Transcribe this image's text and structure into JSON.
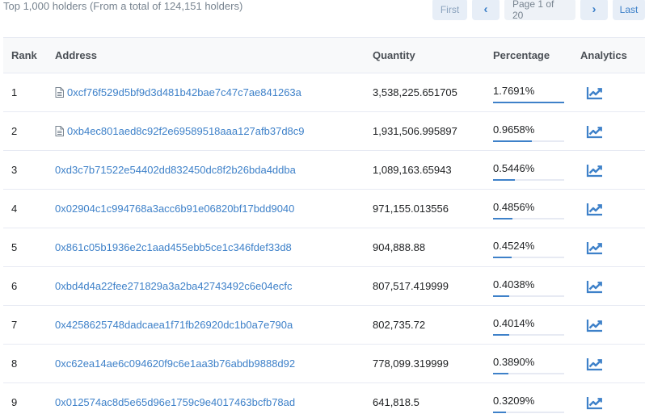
{
  "summary": "Top 1,000 holders (From a total of 124,151 holders)",
  "pager": {
    "first": "First",
    "prev": "‹",
    "info": "Page 1 of 20",
    "next": "›",
    "last": "Last"
  },
  "columns": {
    "rank": "Rank",
    "address": "Address",
    "quantity": "Quantity",
    "percentage": "Percentage",
    "analytics": "Analytics"
  },
  "accent": "#3e81c9",
  "icons": {
    "contract": "contract-doc-icon",
    "analytics": "chart-trend-icon"
  },
  "rows": [
    {
      "rank": "1",
      "address": "0xcf76f529d5bf9d3d481b42bae7c47c7ae841263a",
      "contract": true,
      "quantity": "3,538,225.651705",
      "percentage": "1.7691%",
      "pct_fill": 1.0
    },
    {
      "rank": "2",
      "address": "0xb4ec801aed8c92f2e69589518aaa127afb37d8c9",
      "contract": true,
      "quantity": "1,931,506.995897",
      "percentage": "0.9658%",
      "pct_fill": 0.546
    },
    {
      "rank": "3",
      "address": "0xd3c7b71522e54402dd832450dc8f2b26bda4ddba",
      "contract": false,
      "quantity": "1,089,163.65943",
      "percentage": "0.5446%",
      "pct_fill": 0.308
    },
    {
      "rank": "4",
      "address": "0x02904c1c994768a3acc6b91e06820bf17bdd9040",
      "contract": false,
      "quantity": "971,155.013556",
      "percentage": "0.4856%",
      "pct_fill": 0.274
    },
    {
      "rank": "5",
      "address": "0x861c05b1936e2c1aad455ebb5ce1c346fdef33d8",
      "contract": false,
      "quantity": "904,888.88",
      "percentage": "0.4524%",
      "pct_fill": 0.256
    },
    {
      "rank": "6",
      "address": "0xbd4d4a22fee271829a3a2ba42743492c6e04ecfc",
      "contract": false,
      "quantity": "807,517.419999",
      "percentage": "0.4038%",
      "pct_fill": 0.228
    },
    {
      "rank": "7",
      "address": "0x4258625748dadcaea1f71fb26920dc1b0a7e790a",
      "contract": false,
      "quantity": "802,735.72",
      "percentage": "0.4014%",
      "pct_fill": 0.227
    },
    {
      "rank": "8",
      "address": "0xc62ea14ae6c094620f9c6e1aa3b76abdb9888d92",
      "contract": false,
      "quantity": "778,099.319999",
      "percentage": "0.3890%",
      "pct_fill": 0.22
    },
    {
      "rank": "9",
      "address": "0x012574ac8d5e65d96e1759c9e4017463bcfb78ad",
      "contract": false,
      "quantity": "641,818.5",
      "percentage": "0.3209%",
      "pct_fill": 0.181
    }
  ]
}
